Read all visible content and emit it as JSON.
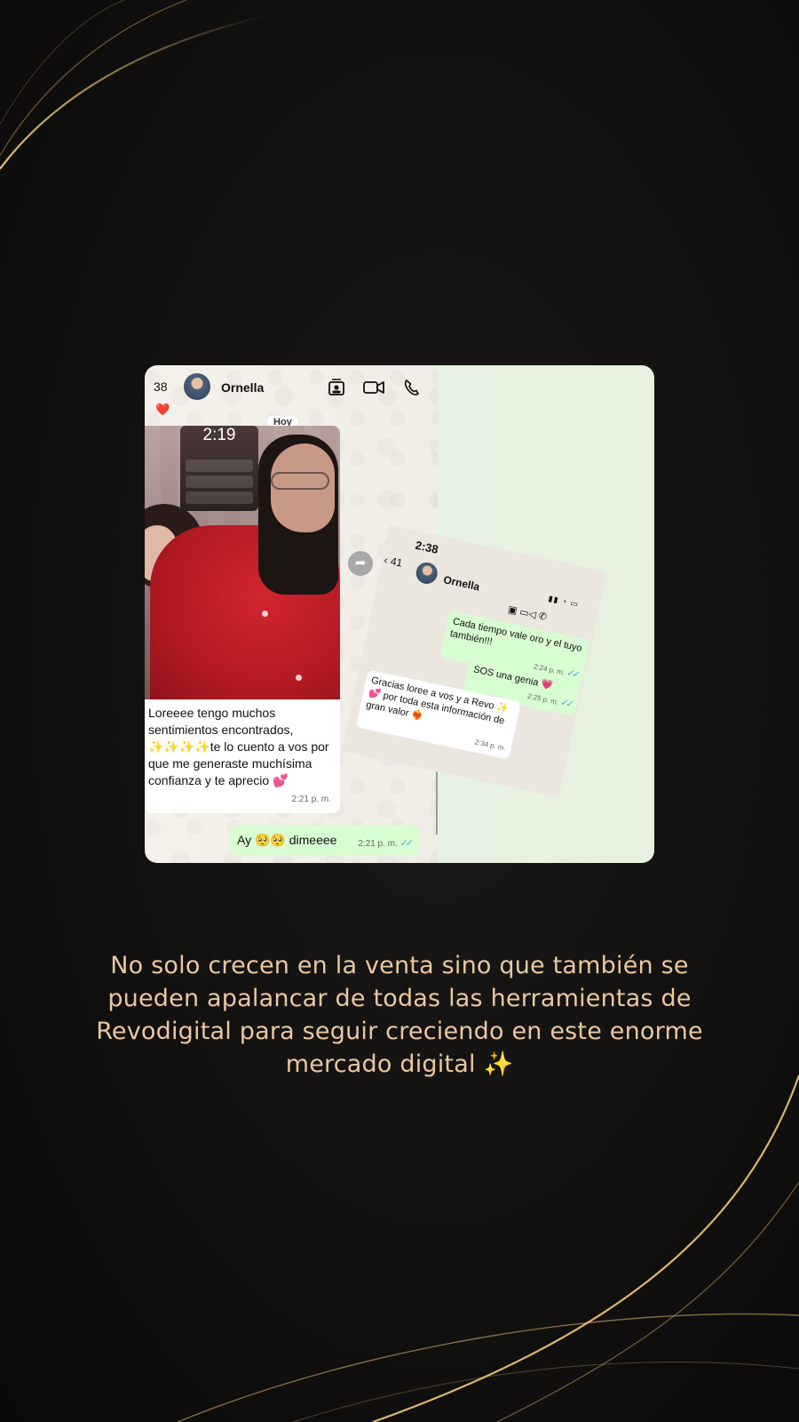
{
  "colors": {
    "accent_gold": "#e9c8a0",
    "chat_outgoing": "#d9fdd3",
    "chat_incoming": "#ffffff",
    "read_ticks": "#4fa7e6"
  },
  "chat_main": {
    "header": {
      "unread_count": "38",
      "contact_name": "Ornella",
      "icons": [
        "contact-card-icon",
        "video-call-icon",
        "phone-call-icon"
      ]
    },
    "reaction": "❤️",
    "day_label": "Hoy",
    "photo_phone_clock": "2:19",
    "incoming_message": {
      "text": "Loreeee tengo muchos sentimientos encontrados, ✨✨✨✨te lo cuento a vos por que me generaste muchísima confianza y te aprecio 💕",
      "time": "2:21 p. m."
    },
    "outgoing_message": {
      "text": "Ay 🥺🥺 dimeeee",
      "time": "2:21 p. m."
    }
  },
  "chat_overlay": {
    "status_time": "2:38",
    "back_count": "41",
    "contact_name": "Ornella",
    "messages": [
      {
        "direction": "out",
        "text": "Cada tiempo vale oro y el tuyo también!!!",
        "time": "2:24 p. m."
      },
      {
        "direction": "out",
        "text": "SOS una genia 💗",
        "time": "2:25 p. m."
      },
      {
        "direction": "in",
        "text": "Gracias loree a vos y a Revo ✨💕 por toda esta información de gran valor ❤️‍🔥",
        "time": "2:34 p. m."
      }
    ]
  },
  "caption": "No solo crecen en la venta sino que también se pueden apalancar de todas las herramientas de Revodigital para seguir creciendo en este enorme mercado digital ✨"
}
